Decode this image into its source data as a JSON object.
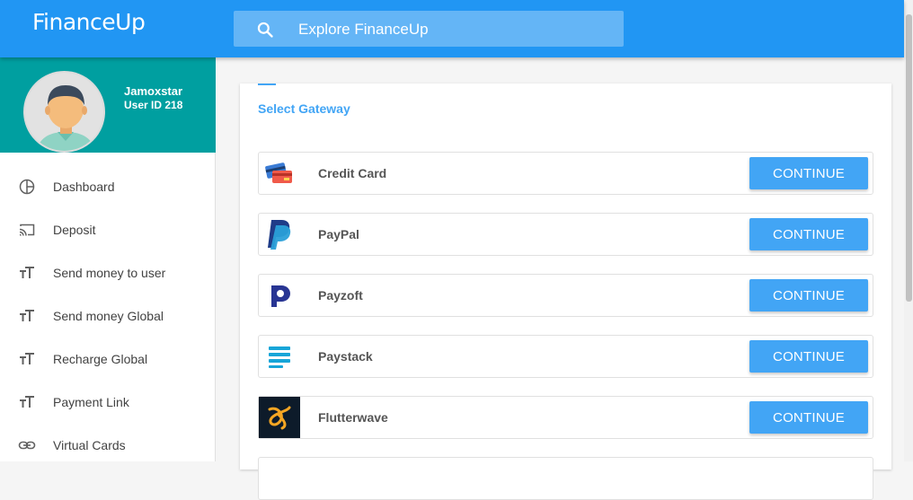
{
  "app": {
    "brand": "FinanceUp"
  },
  "search": {
    "placeholder": "Explore FinanceUp",
    "icon": "search-icon"
  },
  "user": {
    "name": "Jamoxstar",
    "id_label": "User ID 218"
  },
  "sidebar": {
    "items": [
      {
        "label": "Dashboard",
        "icon": "pie-chart-icon"
      },
      {
        "label": "Deposit",
        "icon": "cast-icon"
      },
      {
        "label": "Send money to user",
        "icon": "text-size-icon"
      },
      {
        "label": "Send money Global",
        "icon": "text-size-icon"
      },
      {
        "label": "Recharge Global",
        "icon": "text-size-icon"
      },
      {
        "label": "Payment Link",
        "icon": "text-size-icon"
      },
      {
        "label": "Virtual Cards",
        "icon": "link-icon"
      }
    ]
  },
  "main": {
    "title": "Select Gateway",
    "gateways": [
      {
        "name": "Credit Card",
        "button": "CONTINUE",
        "icon": "credit-card-icon"
      },
      {
        "name": "PayPal",
        "button": "CONTINUE",
        "icon": "paypal-icon"
      },
      {
        "name": "Payzoft",
        "button": "CONTINUE",
        "icon": "payzoft-icon"
      },
      {
        "name": "Paystack",
        "button": "CONTINUE",
        "icon": "paystack-icon"
      },
      {
        "name": "Flutterwave",
        "button": "CONTINUE",
        "icon": "flutterwave-icon"
      }
    ]
  },
  "colors": {
    "primary": "#2196f3",
    "profile_bg": "#009fa0",
    "button": "#42a5f5"
  }
}
